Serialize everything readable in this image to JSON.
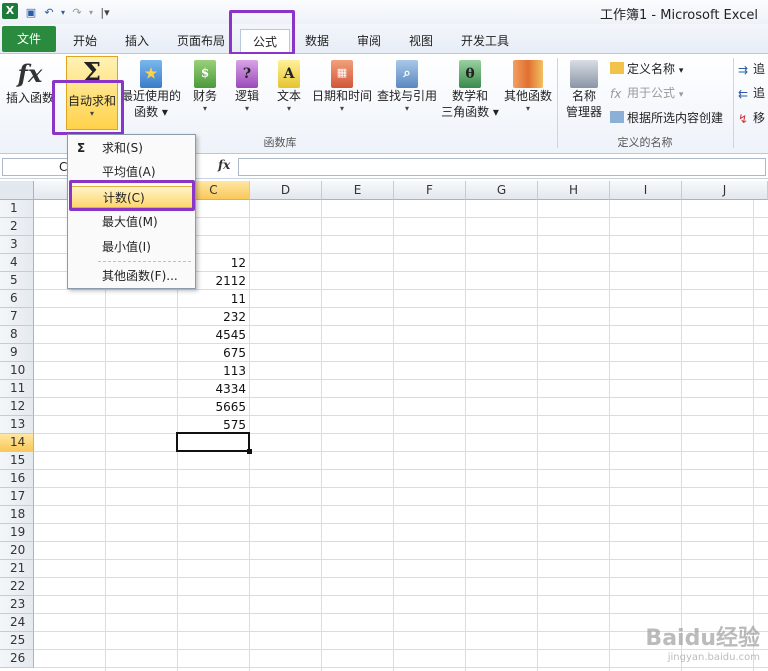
{
  "window": {
    "title": "工作簿1 - Microsoft Excel",
    "app_logo": "X"
  },
  "qat": {
    "icons": [
      "save-icon",
      "undo-icon",
      "redo-icon",
      "customize-icon"
    ]
  },
  "tabs": [
    {
      "label": "文件",
      "active": false
    },
    {
      "label": "开始",
      "active": false
    },
    {
      "label": "插入",
      "active": false
    },
    {
      "label": "页面布局",
      "active": false
    },
    {
      "label": "公式",
      "active": true
    },
    {
      "label": "数据",
      "active": false
    },
    {
      "label": "审阅",
      "active": false
    },
    {
      "label": "视图",
      "active": false
    },
    {
      "label": "开发工具",
      "active": false
    }
  ],
  "ribbon": {
    "insert_function": {
      "label": "插入函数",
      "icon": "fx"
    },
    "autosum": {
      "label": "自动求和",
      "icon": "Σ"
    },
    "recent": {
      "label1": "最近使用的",
      "label2": "函数"
    },
    "financial": {
      "label": "财务"
    },
    "logical": {
      "label": "逻辑",
      "icon": "?"
    },
    "text": {
      "label": "文本",
      "icon": "A"
    },
    "datetime": {
      "label": "日期和时间"
    },
    "lookup": {
      "label": "查找与引用"
    },
    "math": {
      "label1": "数学和",
      "label2": "三角函数",
      "icon": "θ"
    },
    "other": {
      "label": "其他函数"
    },
    "group_function_library": "函数库",
    "name_manager": {
      "label1": "名称",
      "label2": "管理器"
    },
    "define_name": "定义名称",
    "use_in_formula": "用于公式",
    "create_from_selection": "根据所选内容创建",
    "group_defined_names": "定义的名称",
    "trace1": "追",
    "trace2": "追",
    "remove": "移"
  },
  "formula_bar": {
    "name_box": "C",
    "fx": "fx",
    "value": ""
  },
  "columns": [
    "C",
    "D",
    "E",
    "F",
    "G",
    "H",
    "I",
    "J"
  ],
  "rows": [
    "1",
    "2",
    "3",
    "4",
    "5",
    "6",
    "7",
    "8",
    "9",
    "10",
    "11",
    "12",
    "13",
    "14",
    "15",
    "16",
    "17",
    "18",
    "19",
    "20",
    "21",
    "22",
    "23",
    "24",
    "25",
    "26"
  ],
  "active": {
    "row": "14",
    "col": "C"
  },
  "cell_values": [
    {
      "row": 4,
      "value": "12"
    },
    {
      "row": 5,
      "value": "2112"
    },
    {
      "row": 6,
      "value": "11"
    },
    {
      "row": 7,
      "value": "232"
    },
    {
      "row": 8,
      "value": "4545"
    },
    {
      "row": 9,
      "value": "675"
    },
    {
      "row": 10,
      "value": "113"
    },
    {
      "row": 11,
      "value": "4334"
    },
    {
      "row": 12,
      "value": "5665"
    },
    {
      "row": 13,
      "value": "575"
    }
  ],
  "dropdown": {
    "items": [
      {
        "glyph": "Σ",
        "label": "求和(S)"
      },
      {
        "glyph": "",
        "label": "平均值(A)"
      },
      {
        "glyph": "",
        "label": "计数(C)"
      },
      {
        "glyph": "",
        "label": "最大值(M)"
      },
      {
        "glyph": "",
        "label": "最小值(I)"
      },
      {
        "glyph": "",
        "label": "其他函数(F)..."
      }
    ]
  },
  "watermark": {
    "big": "Baidu经验",
    "small": "jingyan.baidu.com"
  },
  "colors": {
    "highlight": "#8b35c8",
    "file_tab": "#2a8a3e",
    "autosum": "#ffd24a"
  }
}
